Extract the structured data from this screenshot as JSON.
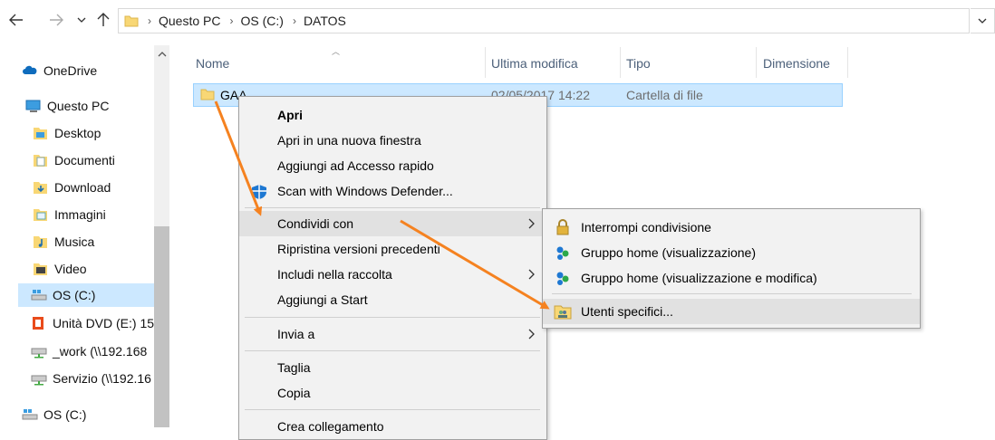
{
  "address_bar": {
    "crumbs": [
      "Questo PC",
      "OS (C:)",
      "DATOS"
    ]
  },
  "nav_pane": {
    "items": [
      {
        "label": "OneDrive",
        "icon": "cloud-icon"
      },
      {
        "label": "Questo PC",
        "icon": "computer-icon"
      },
      {
        "label": "Desktop",
        "icon": "desktop-folder-icon"
      },
      {
        "label": "Documenti",
        "icon": "documents-icon"
      },
      {
        "label": "Download",
        "icon": "download-folder-icon"
      },
      {
        "label": "Immagini",
        "icon": "pictures-icon"
      },
      {
        "label": "Musica",
        "icon": "music-icon"
      },
      {
        "label": "Video",
        "icon": "video-icon"
      },
      {
        "label": "OS (C:)",
        "icon": "drive-icon"
      },
      {
        "label": "Unità DVD (E:) 15",
        "icon": "office-dvd-icon"
      },
      {
        "label": "_work (\\\\192.168",
        "icon": "network-drive-icon"
      },
      {
        "label": "Servizio (\\\\192.16",
        "icon": "network-drive-icon"
      },
      {
        "label": "OS (C:)",
        "icon": "drive-icon"
      }
    ]
  },
  "columns": {
    "name": "Nome",
    "modified": "Ultima modifica",
    "type": "Tipo",
    "size": "Dimensione"
  },
  "files": [
    {
      "name": "GAA",
      "modified": "02/05/2017 14:22",
      "type": "Cartella di file",
      "size": ""
    }
  ],
  "context_menu": {
    "items": [
      {
        "label": "Apri"
      },
      {
        "label": "Apri in una nuova finestra"
      },
      {
        "label": "Aggiungi ad Accesso rapido"
      },
      {
        "label": "Scan with Windows Defender..."
      },
      {
        "label": "Condividi con"
      },
      {
        "label": "Ripristina versioni precedenti"
      },
      {
        "label": "Includi nella raccolta"
      },
      {
        "label": "Aggiungi a Start"
      },
      {
        "label": "Invia a"
      },
      {
        "label": "Taglia"
      },
      {
        "label": "Copia"
      },
      {
        "label": "Crea collegamento"
      }
    ]
  },
  "share_submenu": {
    "items": [
      {
        "label": "Interrompi condivisione",
        "icon": "lock-icon"
      },
      {
        "label": "Gruppo home (visualizzazione)",
        "icon": "homegroup-icon"
      },
      {
        "label": "Gruppo home (visualizzazione e modifica)",
        "icon": "homegroup-icon"
      },
      {
        "label": "Utenti specifici...",
        "icon": "users-icon"
      }
    ]
  },
  "colors": {
    "selection": "#cce8ff",
    "annotation_arrow": "#f58220"
  }
}
